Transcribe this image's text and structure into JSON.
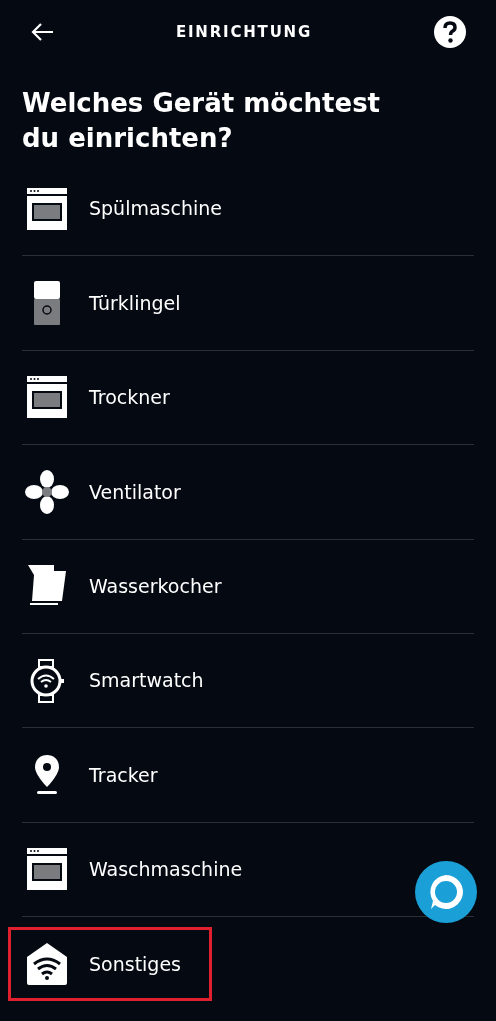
{
  "header": {
    "title": "EINRICHTUNG"
  },
  "heading": "Welches Gerät möchtest du einrichten?",
  "devices": [
    {
      "label": "Spülmaschine",
      "kind": "appliance",
      "highlighted": false
    },
    {
      "label": "Türklingel",
      "kind": "doorbell",
      "highlighted": false
    },
    {
      "label": "Trockner",
      "kind": "appliance",
      "highlighted": false
    },
    {
      "label": "Ventilator",
      "kind": "fan",
      "highlighted": false
    },
    {
      "label": "Wasserkocher",
      "kind": "kettle",
      "highlighted": false
    },
    {
      "label": "Smartwatch",
      "kind": "watch",
      "highlighted": false
    },
    {
      "label": "Tracker",
      "kind": "pin",
      "highlighted": false
    },
    {
      "label": "Waschmaschine",
      "kind": "appliance",
      "highlighted": false
    },
    {
      "label": "Sonstiges",
      "kind": "home",
      "highlighted": true
    }
  ]
}
